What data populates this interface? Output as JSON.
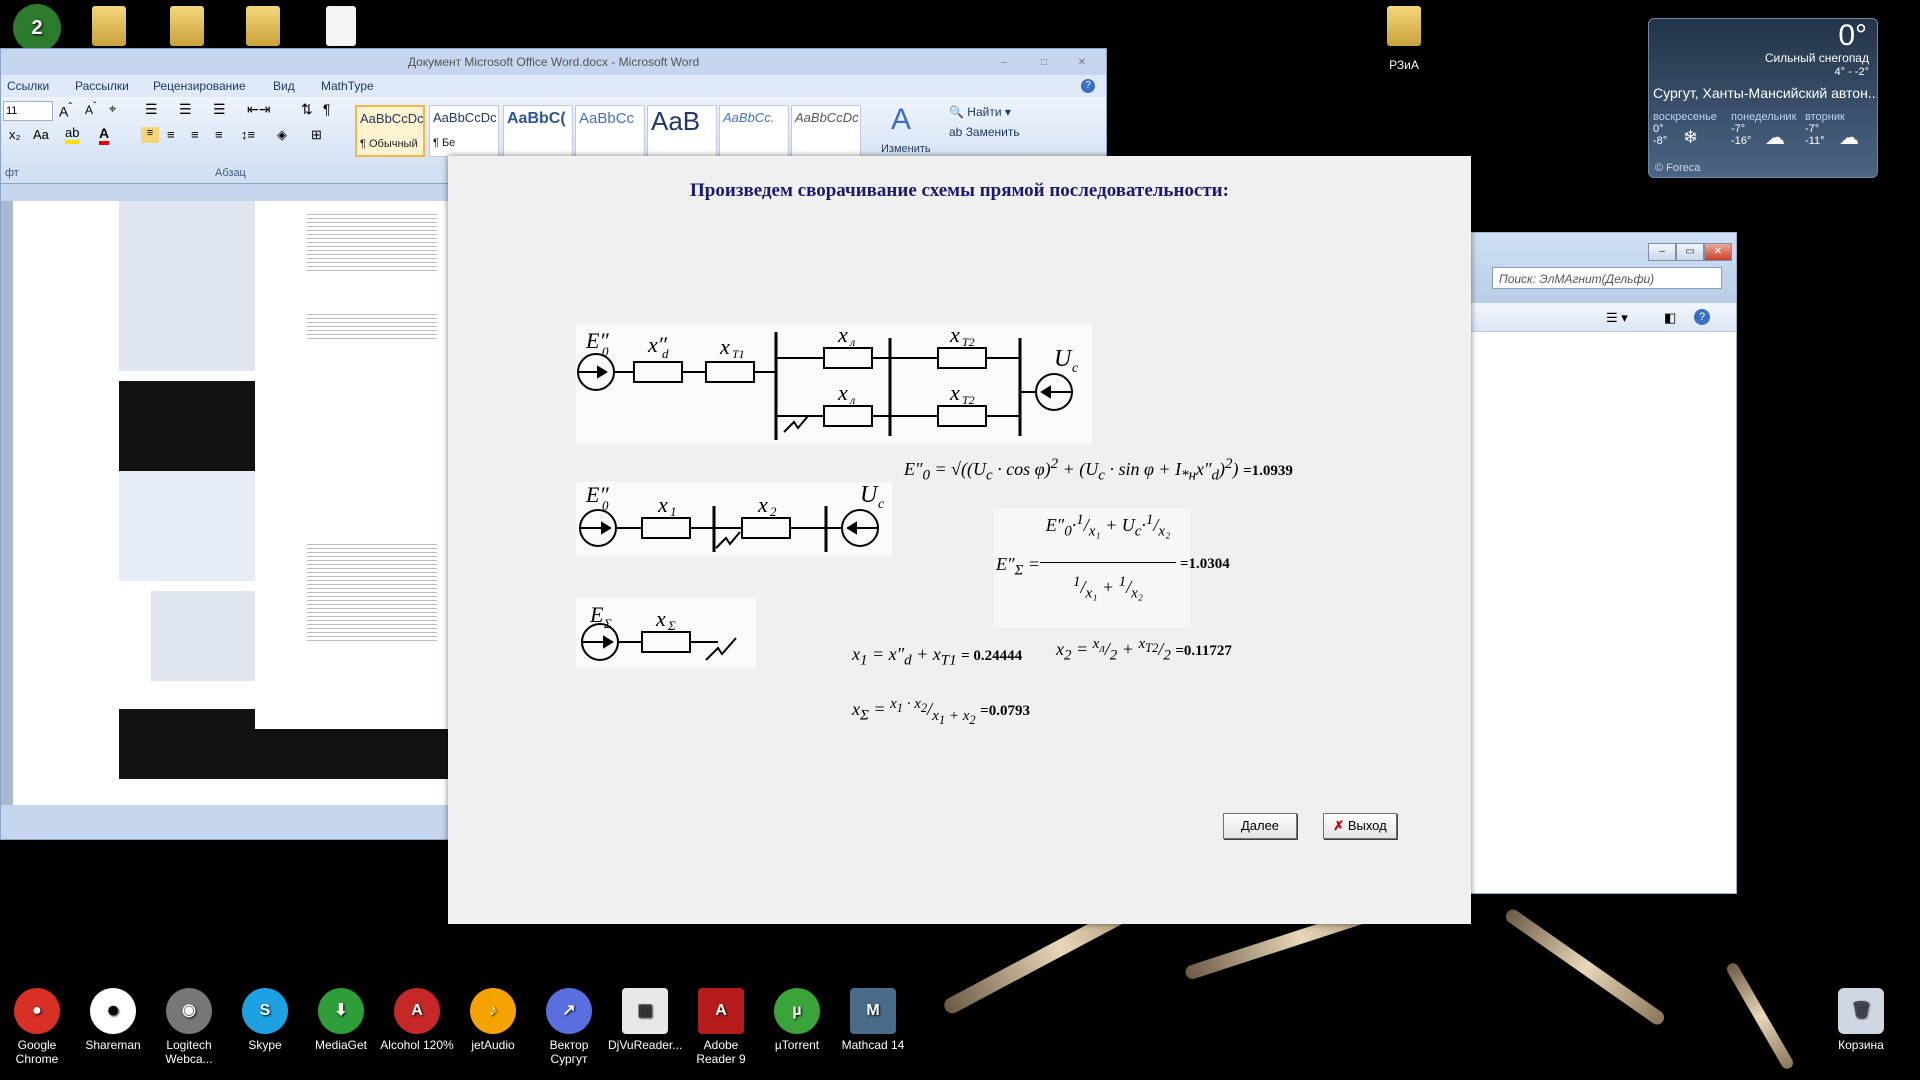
{
  "word": {
    "title": "Документ Microsoft Office Word.docx - Microsoft Word",
    "menu": [
      "Ссылки",
      "Рассылки",
      "Рецензирование",
      "Вид",
      "MathType"
    ],
    "font_size": "11",
    "styles": [
      "AaBbCcDc",
      "AaBbCcDc",
      "AaBbC(",
      "AaBbCc",
      "AaB",
      "AaBbCc.",
      "AaBbCcDc"
    ],
    "style_caption_normal": "¶ Обычный",
    "style_caption_2": "¶ Бе",
    "change_styles": "Изменить",
    "find": "Найти",
    "replace": "Заменить",
    "group_font": "фт",
    "group_paragraph": "Абзац"
  },
  "explorer": {
    "search_placeholder": "Поиск: ЭлМАгнит(Дельфи)"
  },
  "weather": {
    "temp": "0°",
    "condition": "Сильный снегопад",
    "range": "4° - -2°",
    "city": "Сургут, Ханты-Мансийский автон...",
    "days": [
      {
        "name": "воскресенье",
        "hi": "0°",
        "lo": "-8°"
      },
      {
        "name": "понедельник",
        "hi": "-7°",
        "lo": "-16°"
      },
      {
        "name": "вторник",
        "hi": "-7°",
        "lo": "-11°"
      }
    ],
    "brand": "© Foreca"
  },
  "dialog": {
    "title": "Произведем сворачивание схемы прямой последовательности:",
    "e0_value": "=1.0939",
    "esum_value": "=1.0304",
    "x1_value": "= 0.24444",
    "x2_value": "=0.11727",
    "xsum_value": "=0.0793",
    "next_button": "Далее",
    "exit_button": "Выход"
  },
  "desktop": {
    "folder_label": "РЗиА",
    "recycle_label": "Корзина"
  },
  "taskbar": [
    {
      "label": "Google Chrome",
      "icon": "chrome-icon",
      "color": "#d93025"
    },
    {
      "label": "Shareman",
      "icon": "shareman-icon",
      "color": "#333333"
    },
    {
      "label": "Logitech Webca...",
      "icon": "webcam-icon",
      "color": "#666666"
    },
    {
      "label": "Skype",
      "icon": "skype-icon",
      "color": "#1da1e2"
    },
    {
      "label": "MediaGet",
      "icon": "mediaget-icon",
      "color": "#2e9e3b"
    },
    {
      "label": "Alcohol 120%",
      "icon": "alcohol-icon",
      "color": "#c62828"
    },
    {
      "label": "jetAudio",
      "icon": "jetaudio-icon",
      "color": "#f4a300"
    },
    {
      "label": "Вектор Сургут",
      "icon": "vector-icon",
      "color": "#5b6ee0"
    },
    {
      "label": "DjVuReader...",
      "icon": "djvu-icon",
      "color": "#e8e8e8"
    },
    {
      "label": "Adobe Reader 9",
      "icon": "adobe-icon",
      "color": "#b71c1c"
    },
    {
      "label": "µTorrent",
      "icon": "utorrent-icon",
      "color": "#3aa33a"
    },
    {
      "label": "Mathcad 14",
      "icon": "mathcad-icon",
      "color": "#4a6a8a"
    }
  ]
}
